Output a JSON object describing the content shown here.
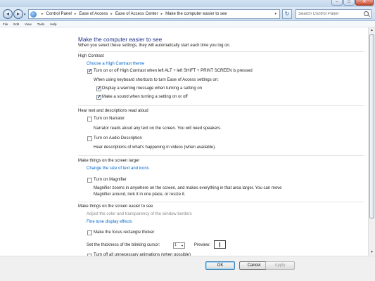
{
  "window": {
    "minimize_glyph": "–",
    "maximize_glyph": "□",
    "close_glyph": "✕"
  },
  "address": {
    "crumbs": [
      "Control Panel",
      "Ease of Access",
      "Ease of Access Center",
      "Make the computer easier to see"
    ],
    "separator": "▸",
    "search_placeholder": "Search Control Panel"
  },
  "menu": [
    "File",
    "Edit",
    "View",
    "Tools",
    "Help"
  ],
  "page": {
    "title": "Make the computer easier to see",
    "subtitle": "When you select these settings, they will automatically start each time you log on."
  },
  "high_contrast": {
    "heading": "High Contrast",
    "choose_link": "Choose a High Contrast theme",
    "toggle_label": "Turn on or off High Contrast when left ALT + left SHIFT + PRINT SCREEN is pressed",
    "toggle_checked": true,
    "shortcut_caption": "When using keyboard shortcuts to turn Ease of Access settings on:",
    "warning_label": "Display a warning message when turning a setting on",
    "warning_checked": true,
    "sound_label": "Make a sound when turning a setting on or off",
    "sound_checked": true
  },
  "narration": {
    "heading": "Hear text and descriptions read aloud",
    "narrator_label": "Turn on Narrator",
    "narrator_checked": false,
    "narrator_desc": "Narrator reads aloud any text on the screen. You will need speakers.",
    "audio_label": "Turn on Audio Description",
    "audio_checked": false,
    "audio_desc": "Hear descriptions of what's happening in videos (when available)."
  },
  "larger": {
    "heading": "Make things on the screen larger",
    "size_link": "Change the size of text and icons",
    "magnifier_label": "Turn on Magnifier",
    "magnifier_checked": false,
    "magnifier_desc_1": "Magnifier zooms in anywhere on the screen, and makes everything in that area larger. You can move",
    "magnifier_desc_2": "Magnifier around, lock it in one place, or resize it."
  },
  "easier": {
    "heading": "Make things on the screen easier to see",
    "transparency_link": "Adjust the color and transparency of the window borders",
    "effects_link": "Fine tune display effects",
    "focus_label": "Make the focus rectangle thicker",
    "focus_checked": false,
    "cursor_label": "Set the thickness of the blinking cursor:",
    "cursor_value": "1",
    "preview_label": "Preview:",
    "animations_label": "Turn off all unnecessary animations (when possible)",
    "animations_checked": false
  },
  "buttons": {
    "ok": "OK",
    "cancel": "Cancel",
    "apply": "Apply"
  }
}
